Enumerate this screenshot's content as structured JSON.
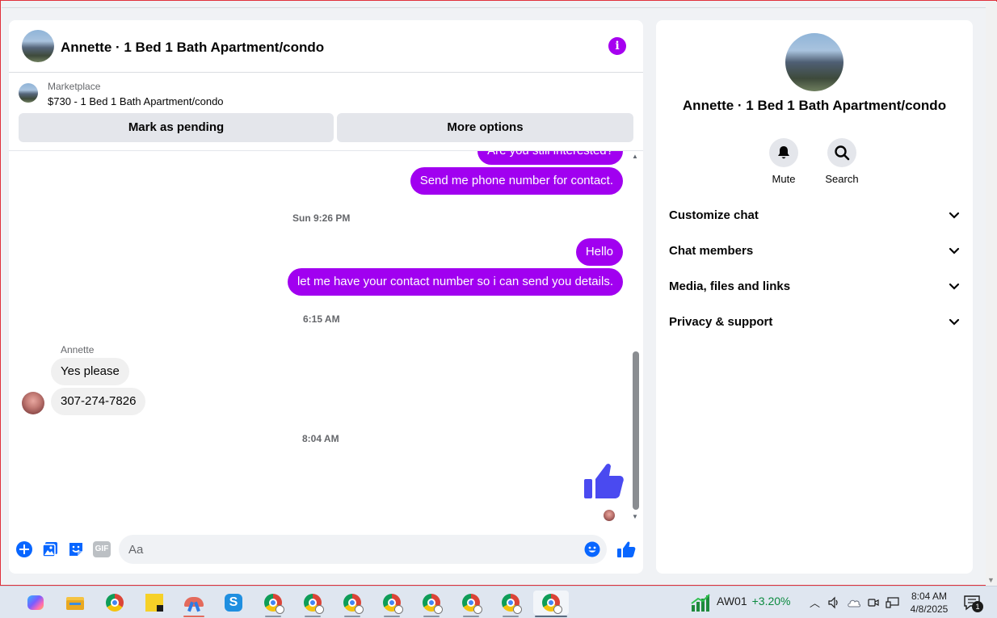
{
  "chat": {
    "title": "Annette · 1 Bed 1 Bath Apartment/condo",
    "marketplace_label": "Marketplace",
    "listing": "$730 - 1 Bed 1 Bath Apartment/condo",
    "mark_pending_label": "Mark as pending",
    "more_options_label": "More options",
    "messages": {
      "m1": "Are you still interested?",
      "m2": "Send me phone number for contact.",
      "t1": "Sun 9:26 PM",
      "m3": "Hello",
      "m4": "let me have your contact number so i can send you details.",
      "t2": "6:15 AM",
      "sender": "Annette",
      "r1": "Yes please",
      "r2": "307-274-7826",
      "t3": "8:04 AM"
    },
    "composer": {
      "placeholder": "Aa",
      "gif_label": "GIF"
    },
    "accent_color": "#a100f0",
    "link_blue": "#0866ff"
  },
  "details": {
    "title": "Annette · 1 Bed 1 Bath Apartment/condo",
    "actions": {
      "mute": "Mute",
      "search": "Search"
    },
    "sections": {
      "customize": "Customize chat",
      "members": "Chat members",
      "media": "Media, files and links",
      "privacy": "Privacy & support"
    }
  },
  "taskbar": {
    "stock_name": "AW01",
    "stock_change": "+3.20%",
    "time": "8:04 AM",
    "date": "4/8/2025",
    "notification_count": "1",
    "apps": [
      "copilot-icon",
      "file-explorer-icon",
      "chrome-icon",
      "sticky-notes-icon",
      "snipping-tool-icon",
      "skype-icon",
      "chrome-profile-icon"
    ]
  }
}
